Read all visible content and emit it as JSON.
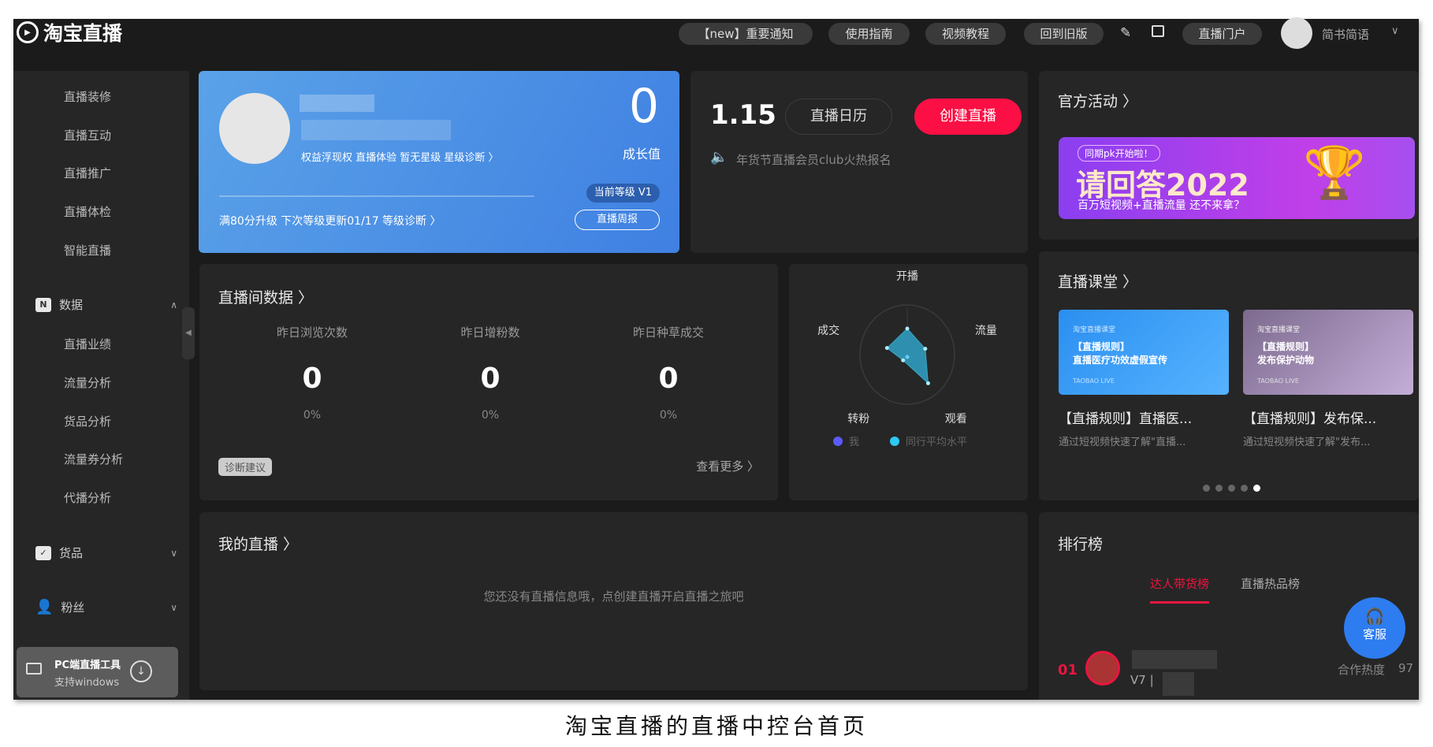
{
  "header": {
    "logo": "淘宝直播",
    "buttons": [
      "【new】重要通知",
      "使用指南",
      "视频教程",
      "回到旧版"
    ],
    "portal": "直播门户",
    "username": "简书简语"
  },
  "sidebar": {
    "items_top": [
      "直播装修",
      "直播互动",
      "直播推广",
      "直播体检",
      "智能直播"
    ],
    "data_group": "数据",
    "data_items": [
      "直播业绩",
      "流量分析",
      "货品分析",
      "流量券分析",
      "代播分析"
    ],
    "goods_group": "货品",
    "fans_group": "粉丝",
    "pc_tool_title": "PC端直播工具",
    "pc_tool_sub": "支持windows"
  },
  "profile": {
    "growth_value": "0",
    "growth_label": "成长值",
    "links": "权益浮现权  直播体验  暂无星级  星级诊断 〉",
    "level": "当前等级 V1",
    "weekly": "直播周报",
    "upgrade": "满80分升级  下次等级更新01/17  等级诊断 〉"
  },
  "calendar": {
    "date": "1.15",
    "calendar_btn": "直播日历",
    "create_btn": "创建直播",
    "notice": "年货节直播会员club火热报名"
  },
  "activity": {
    "title": "官方活动 〉",
    "banner_tag": "同期pk开始啦！",
    "banner_title": "请回答2022",
    "banner_sub": "百万短视频+直播流量 还不来拿？"
  },
  "room_data": {
    "title": "直播间数据 〉",
    "stats": [
      {
        "label": "昨日浏览次数",
        "value": "0",
        "pct": "0%"
      },
      {
        "label": "昨日增粉数",
        "value": "0",
        "pct": "0%"
      },
      {
        "label": "昨日种草成交",
        "value": "0",
        "pct": "0%"
      }
    ],
    "diagnose": "诊断建议",
    "more": "查看更多 〉"
  },
  "radar": {
    "axes": [
      "开播",
      "流量",
      "观看",
      "转粉",
      "成交"
    ],
    "values": [
      0.55,
      0.4,
      0.75,
      0.15,
      0.45
    ],
    "legend": [
      "我",
      "同行平均水平"
    ],
    "colors": [
      "#5a5aff",
      "#2ec8f0"
    ]
  },
  "course": {
    "title": "直播课堂 〉",
    "cards": [
      {
        "thumb_tag": "淘宝直播课堂",
        "thumb_title": "【直播规则】\n直播医疗功效虚假宣传",
        "title": "【直播规则】直播医...",
        "desc": "通过短视频快速了解\"直播..."
      },
      {
        "thumb_tag": "淘宝直播课堂",
        "thumb_title": "【直播规则】\n发布保护动物",
        "title": "【直播规则】发布保...",
        "desc": "通过短视频快速了解\"发布..."
      }
    ],
    "thumb_brand": "TAOBAO LIVE",
    "pages": 5,
    "active_page": 5
  },
  "my_live": {
    "title": "我的直播 〉",
    "empty": "您还没有直播信息哦，点创建直播开启直播之旅吧"
  },
  "ranking": {
    "title": "排行榜",
    "tabs": [
      "达人带货榜",
      "直播热品榜"
    ],
    "rank": "01",
    "level": "V7 |",
    "heat_label": "合作热度",
    "heat_value": "97"
  },
  "service": {
    "label": "客服"
  },
  "caption": "淘宝直播的直播中控台首页"
}
